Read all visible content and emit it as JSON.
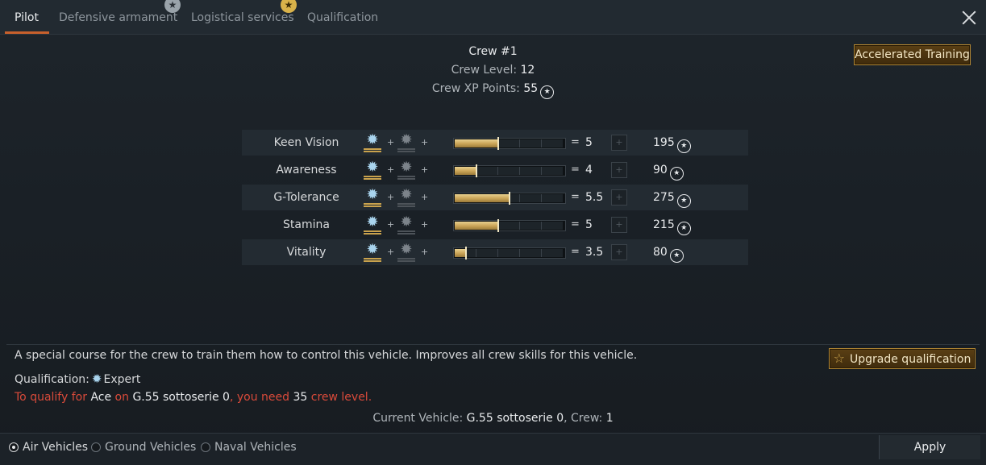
{
  "tabs": [
    {
      "label": "Pilot"
    },
    {
      "label": "Defensive armament"
    },
    {
      "label": "Logistical services"
    },
    {
      "label": "Qualification"
    }
  ],
  "crew": {
    "title": "Crew #1",
    "level_label": "Crew Level:",
    "level_value": "12",
    "xp_label": "Crew XP Points:",
    "xp_value": "55"
  },
  "accelerated_training_label": "Accelerated Training",
  "skills": [
    {
      "name": "Keen Vision",
      "value": "5",
      "cost": "195",
      "progress": 0.4
    },
    {
      "name": "Awareness",
      "value": "4",
      "cost": "90",
      "progress": 0.2
    },
    {
      "name": "G-Tolerance",
      "value": "5.5",
      "cost": "275",
      "progress": 0.5
    },
    {
      "name": "Stamina",
      "value": "5",
      "cost": "215",
      "progress": 0.4
    },
    {
      "name": "Vitality",
      "value": "3.5",
      "cost": "80",
      "progress": 0.1
    }
  ],
  "symbols": {
    "plus": "+",
    "equals": "=",
    "plus_button": "+",
    "xp": "★"
  },
  "qualification_info": {
    "description": "A special course for the crew to train them how to control this vehicle. Improves all crew skills for this vehicle.",
    "label": "Qualification:",
    "value": "Expert",
    "req_1": "To qualify for",
    "req_target": "Ace",
    "req_2": "on",
    "req_vehicle": "G.55 sottoserie 0",
    "req_3": ", you need",
    "req_level": "35",
    "req_4": "crew level."
  },
  "upgrade_label": "Upgrade qualification",
  "current_vehicle": {
    "label": "Current Vehicle:",
    "vehicle": "G.55 sottoserie 0",
    "crew_label": ", Crew:",
    "crew_value": "1"
  },
  "vehicle_types": [
    {
      "label": "Air Vehicles",
      "selected": true
    },
    {
      "label": "Ground Vehicles",
      "selected": false
    },
    {
      "label": "Naval Vehicles",
      "selected": false
    }
  ],
  "apply_label": "Apply"
}
